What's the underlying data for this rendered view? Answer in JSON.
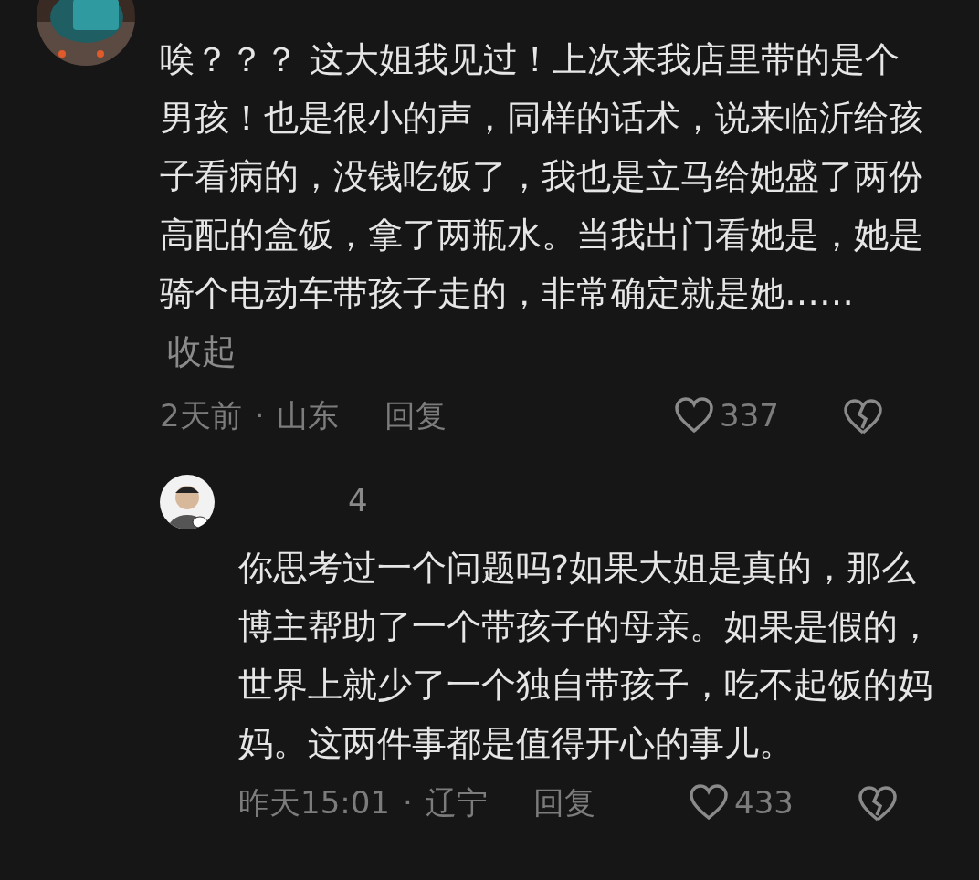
{
  "comments": [
    {
      "text": "唉？？？ 这大姐我见过！上次来我店里带的是个男孩！也是很小的声，同样的话术，说来临沂给孩子看病的，没钱吃饭了，我也是立马给她盛了两份高配的盒饭，拿了两瓶水。当我出门看她是，她是骑个电动车带孩子走的，非常确定就是她……",
      "collapse": "收起",
      "time": "2天前",
      "separator": "·",
      "location": "山东",
      "reply": "回复",
      "likes": "337",
      "replies": [
        {
          "username": "4",
          "text": "你思考过一个问题吗?如果大姐是真的，那么博主帮助了一个带孩子的母亲。如果是假的，世界上就少了一个独自带孩子，吃不起饭的妈妈。这两件事都是值得开心的事儿。",
          "time": "昨天15:01",
          "separator": "·",
          "location": "辽宁",
          "reply": "回复",
          "likes": "433"
        }
      ]
    }
  ]
}
